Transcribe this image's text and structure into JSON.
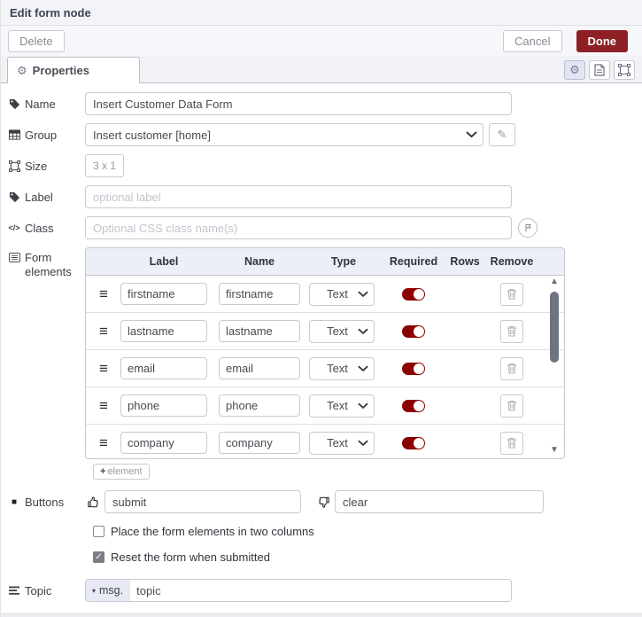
{
  "dialog": {
    "title": "Edit form node"
  },
  "toolbar": {
    "delete": "Delete",
    "cancel": "Cancel",
    "done": "Done"
  },
  "tab": {
    "properties": "Properties"
  },
  "icons": {
    "gear": "⚙",
    "pencil": "✎",
    "drag_handle": "≡",
    "caret_down": "▾",
    "scroll_up": "▲",
    "scroll_down": "▼",
    "plus": "+",
    "check": "✓",
    "buttons_square": "■",
    "class_code": "</>"
  },
  "fields": {
    "name": {
      "label": "Name",
      "value": "Insert Customer Data Form"
    },
    "group": {
      "label": "Group",
      "value": "Insert customer [home]"
    },
    "size": {
      "label": "Size",
      "value": "3 x 1"
    },
    "label": {
      "label": "Label",
      "placeholder": "optional label"
    },
    "class": {
      "label": "Class",
      "placeholder": "Optional CSS class name(s)"
    },
    "form_elements_label": "Form elements",
    "buttons": {
      "label": "Buttons",
      "submit": "submit",
      "clear": "clear"
    },
    "checkboxes": [
      {
        "label": "Place the form elements in two columns",
        "checked": false
      },
      {
        "label": "Reset the form when submitted",
        "checked": true
      }
    ],
    "topic": {
      "label": "Topic",
      "prefix": "msg.",
      "value": "topic"
    }
  },
  "form_table": {
    "headers": [
      "Label",
      "Name",
      "Type",
      "Required",
      "Rows",
      "Remove"
    ],
    "add_button": "element",
    "rows": [
      {
        "label": "firstname",
        "name": "firstname",
        "type": "Text",
        "required": true
      },
      {
        "label": "lastname",
        "name": "lastname",
        "type": "Text",
        "required": true
      },
      {
        "label": "email",
        "name": "email",
        "type": "Text",
        "required": true
      },
      {
        "label": "phone",
        "name": "phone",
        "type": "Text",
        "required": true
      },
      {
        "label": "company",
        "name": "company",
        "type": "Text",
        "required": true
      }
    ]
  },
  "colors": {
    "done_button": "#8e1f24",
    "required_toggle": "#8b0000",
    "table_header_bg": "#edeff6",
    "prefix_bg": "#e7e9f5"
  }
}
